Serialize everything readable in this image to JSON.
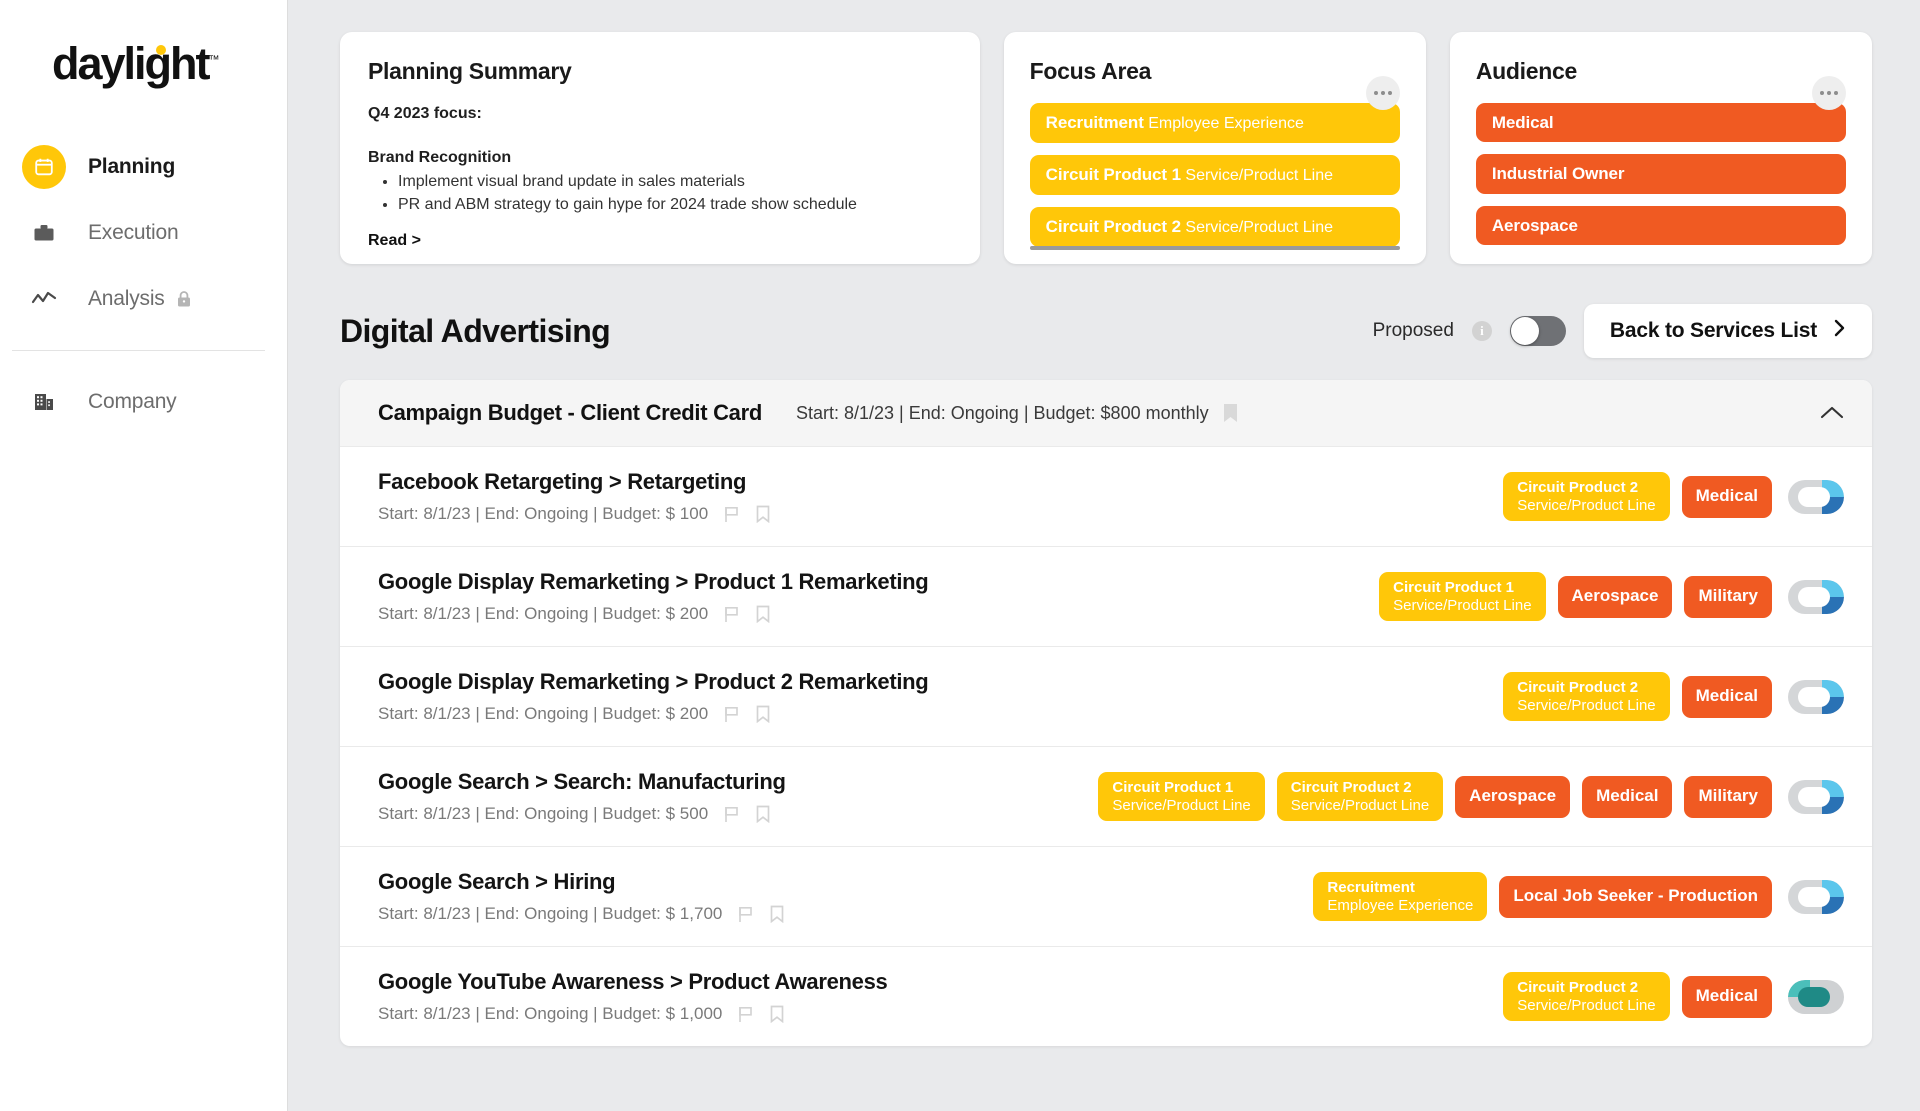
{
  "brand": {
    "name": "daylight",
    "trademark": "™"
  },
  "sidebar": {
    "items": [
      {
        "label": "Planning",
        "icon": "calendar-icon",
        "active": true,
        "locked": false
      },
      {
        "label": "Execution",
        "icon": "briefcase-icon",
        "active": false,
        "locked": false
      },
      {
        "label": "Analysis",
        "icon": "trend-line-icon",
        "active": false,
        "locked": true
      },
      {
        "label": "Company",
        "icon": "building-icon",
        "active": false,
        "locked": false
      }
    ]
  },
  "planning_summary": {
    "title": "Planning Summary",
    "subtitle": "Q4 2023 focus:",
    "heading": "Brand Recognition",
    "bullets": [
      "Implement visual brand update in sales materials",
      "PR and ABM strategy to gain hype for 2024 trade show schedule"
    ],
    "read_link": "Read >"
  },
  "focus_area": {
    "title": "Focus Area",
    "menu_icon": "ellipsis-icon",
    "tags": [
      {
        "title": "Recruitment",
        "sub": "Employee Experience"
      },
      {
        "title": "Circuit Product 1",
        "sub": "Service/Product Line"
      },
      {
        "title": "Circuit Product 2",
        "sub": "Service/Product Line"
      }
    ]
  },
  "audience": {
    "title": "Audience",
    "menu_icon": "ellipsis-icon",
    "tags": [
      {
        "title": "Medical"
      },
      {
        "title": "Industrial Owner"
      },
      {
        "title": "Aerospace"
      }
    ]
  },
  "section": {
    "title": "Digital Advertising",
    "proposed_label": "Proposed",
    "proposed_info_icon": "info-icon",
    "proposed_toggle_state": "off",
    "back_button": "Back to Services List",
    "back_button_icon": "chevron-right-icon"
  },
  "budget_group": {
    "title": "Campaign Budget - Client Credit Card",
    "meta": "Start: 8/1/23 | End: Ongoing | Budget: $800 monthly",
    "bookmark_icon": "bookmark-filled-icon",
    "collapse_icon": "chevron-up-icon"
  },
  "campaigns": [
    {
      "title": "Facebook Retargeting > Retargeting",
      "meta": "Start: 8/1/23 | End: Ongoing | Budget: $ 100",
      "chips": [
        {
          "kind": "yellow",
          "title": "Circuit Product 2",
          "sub": "Service/Product Line"
        },
        {
          "kind": "orange",
          "title": "Medical"
        }
      ],
      "toggle": "off"
    },
    {
      "title": "Google Display Remarketing > Product 1 Remarketing",
      "meta": "Start: 8/1/23 | End: Ongoing | Budget: $ 200",
      "chips": [
        {
          "kind": "yellow",
          "title": "Circuit Product 1",
          "sub": "Service/Product Line"
        },
        {
          "kind": "orange",
          "title": "Aerospace"
        },
        {
          "kind": "orange",
          "title": "Military"
        }
      ],
      "toggle": "off"
    },
    {
      "title": "Google Display Remarketing > Product 2 Remarketing",
      "meta": "Start: 8/1/23 | End: Ongoing | Budget: $ 200",
      "chips": [
        {
          "kind": "yellow",
          "title": "Circuit Product 2",
          "sub": "Service/Product Line"
        },
        {
          "kind": "orange",
          "title": "Medical"
        }
      ],
      "toggle": "off"
    },
    {
      "title": "Google Search > Search: Manufacturing",
      "meta": "Start: 8/1/23 | End: Ongoing | Budget: $ 500",
      "chips": [
        {
          "kind": "yellow",
          "title": "Circuit Product 1",
          "sub": "Service/Product Line"
        },
        {
          "kind": "yellow",
          "title": "Circuit Product 2",
          "sub": "Service/Product Line"
        },
        {
          "kind": "orange",
          "title": "Aerospace"
        },
        {
          "kind": "orange",
          "title": "Medical"
        },
        {
          "kind": "orange",
          "title": "Military"
        }
      ],
      "toggle": "off"
    },
    {
      "title": "Google Search > Hiring",
      "meta": "Start: 8/1/23 | End: Ongoing | Budget: $ 1,700",
      "chips": [
        {
          "kind": "yellow",
          "title": "Recruitment",
          "sub": "Employee Experience"
        },
        {
          "kind": "orange",
          "title": "Local Job Seeker - Production"
        }
      ],
      "toggle": "off"
    },
    {
      "title": "Google YouTube Awareness > Product Awareness",
      "meta": "Start: 8/1/23 | End: Ongoing | Budget: $ 1,000",
      "chips": [
        {
          "kind": "yellow",
          "title": "Circuit Product 2",
          "sub": "Service/Product Line"
        },
        {
          "kind": "orange",
          "title": "Medical"
        }
      ],
      "toggle": "on"
    }
  ],
  "row_icons": {
    "flag": "flag-outline-icon",
    "bookmark": "bookmark-outline-icon"
  },
  "colors": {
    "accent_yellow": "#FFC709",
    "accent_orange": "#F05A22",
    "toggle_on": "#4BBFBA",
    "toggle_off_light": "#5BC6EC",
    "toggle_off_dark": "#2A72B5",
    "page_bg": "#E9EAEC"
  }
}
